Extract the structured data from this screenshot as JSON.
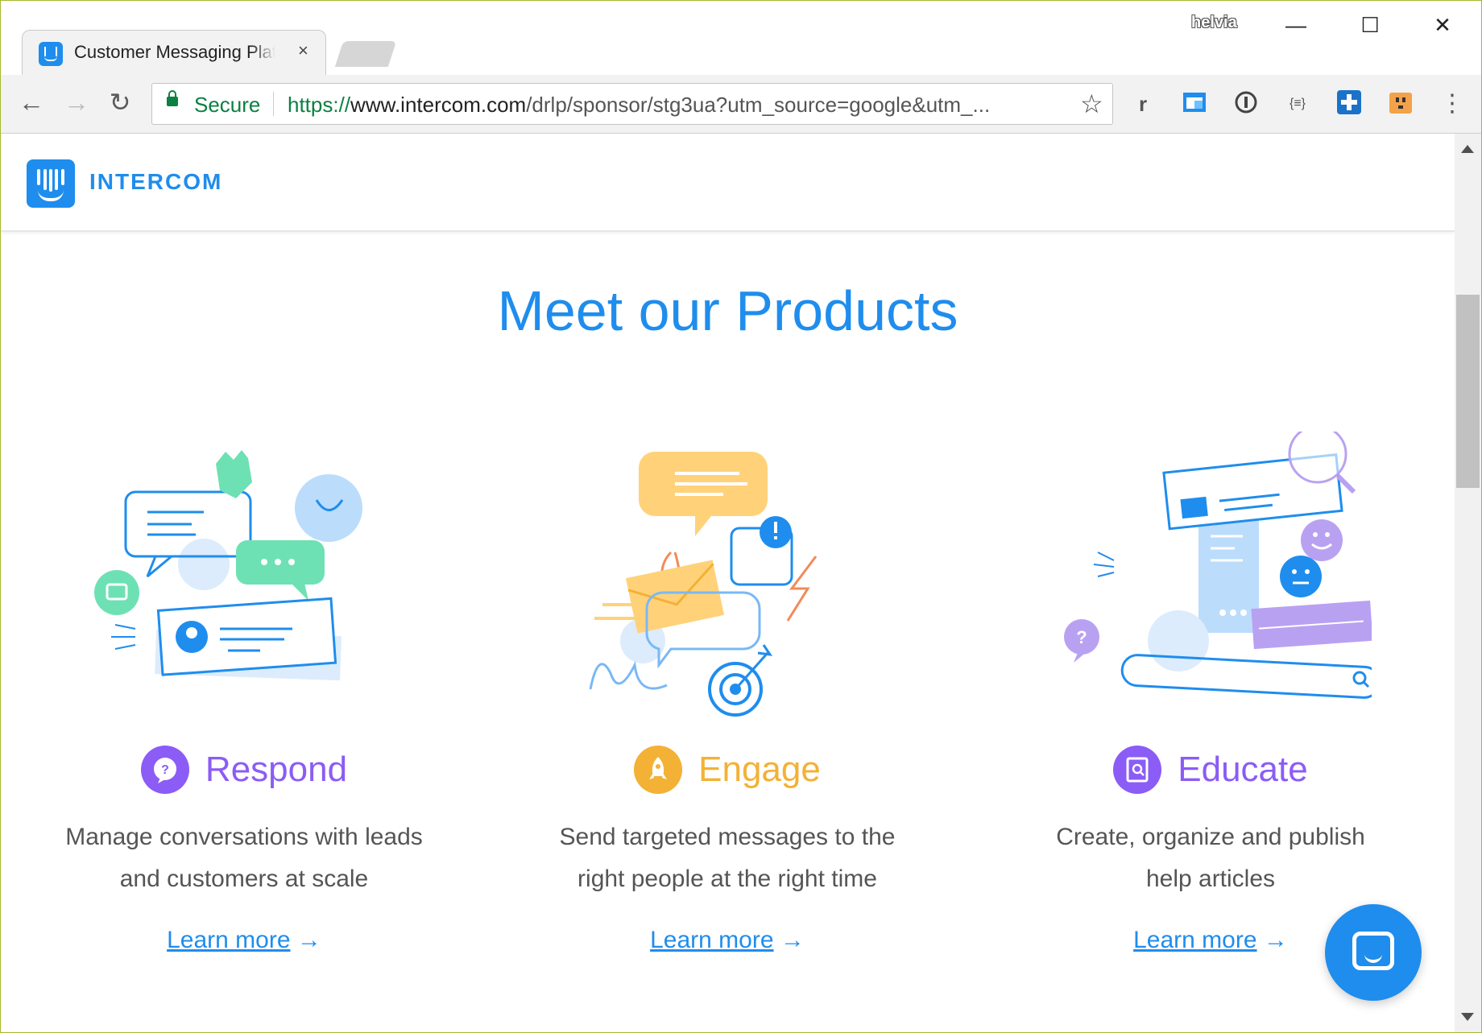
{
  "browser": {
    "tab_title": "Customer Messaging Platform | Intercom",
    "tab_close": "×",
    "profile_name": "helvia",
    "controls": {
      "minimize": "—",
      "maximize": "☐",
      "close": "✕"
    },
    "secure_label": "Secure",
    "url_scheme": "https://",
    "url_host": "www.intercom.com",
    "url_path": "/drlp/sponsor/stg3ua?utm_source=google&utm_...",
    "extensions": [
      "r",
      "",
      "",
      "{≡}",
      "",
      ""
    ],
    "menu": "⋮"
  },
  "site": {
    "logo_text": "INTERCOM",
    "heading": "Meet our Products",
    "products": [
      {
        "name": "Respond",
        "description_line1": "Manage conversations with leads",
        "description_line2": "and customers at scale",
        "link": "Learn more",
        "arrow": "→",
        "color": "#8b5cf6"
      },
      {
        "name": "Engage",
        "description_line1": "Send targeted messages to the",
        "description_line2": "right people at the right time",
        "link": "Learn more",
        "arrow": "→",
        "color": "#f3b135"
      },
      {
        "name": "Educate",
        "description_line1": "Create, organize and publish",
        "description_line2": "help articles",
        "link": "Learn more",
        "arrow": "→",
        "color": "#8b5cf6"
      }
    ]
  },
  "colors": {
    "brand": "#1f8ded",
    "secure": "#0b8043",
    "respond": "#8b5cf6",
    "engage": "#f3b135",
    "educate": "#8b5cf6"
  }
}
